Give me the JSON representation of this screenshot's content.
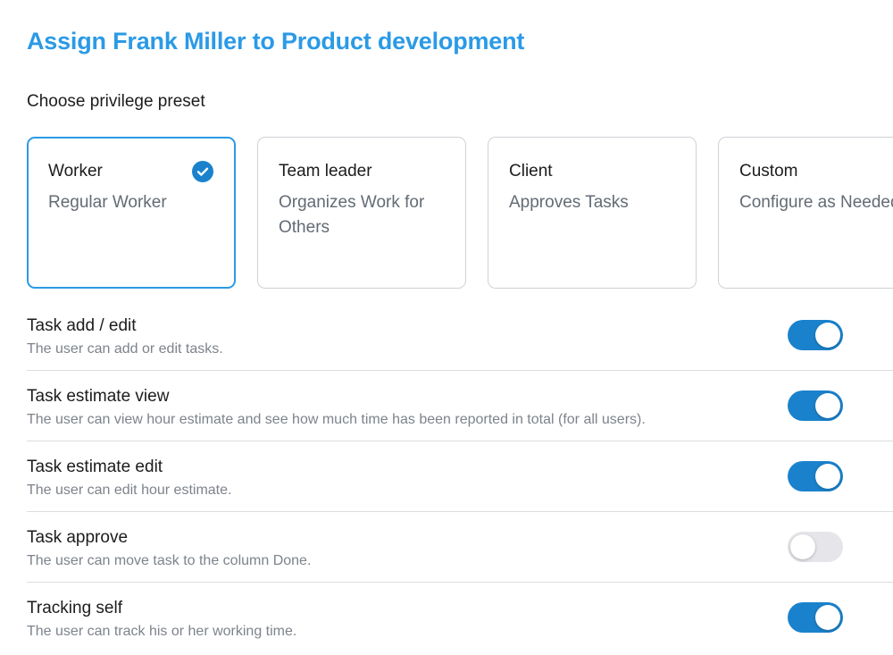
{
  "title": "Assign Frank Miller to Product development",
  "preset_section_label": "Choose privilege preset",
  "presets": [
    {
      "name": "Worker",
      "description": "Regular Worker",
      "selected": true
    },
    {
      "name": "Team leader",
      "description": "Organizes Work for Others",
      "selected": false
    },
    {
      "name": "Client",
      "description": "Approves Tasks",
      "selected": false
    },
    {
      "name": "Custom",
      "description": "Configure as Needed",
      "selected": false
    }
  ],
  "permissions": [
    {
      "title": "Task add / edit",
      "description": "The user can add or edit tasks.",
      "enabled": true
    },
    {
      "title": "Task estimate view",
      "description": "The user can view hour estimate and see how much time has been reported in total (for all users).",
      "enabled": true
    },
    {
      "title": "Task estimate edit",
      "description": "The user can edit hour estimate.",
      "enabled": true
    },
    {
      "title": "Task approve",
      "description": "The user can move task to the column Done.",
      "enabled": false
    },
    {
      "title": "Tracking self",
      "description": "The user can track his or her working time.",
      "enabled": true
    }
  ],
  "colors": {
    "accent": "#2b9ae6",
    "toggle_on": "#1a82cc",
    "toggle_off": "#e5e5ea"
  },
  "icons": {
    "selected_check": "check-circle-icon"
  }
}
